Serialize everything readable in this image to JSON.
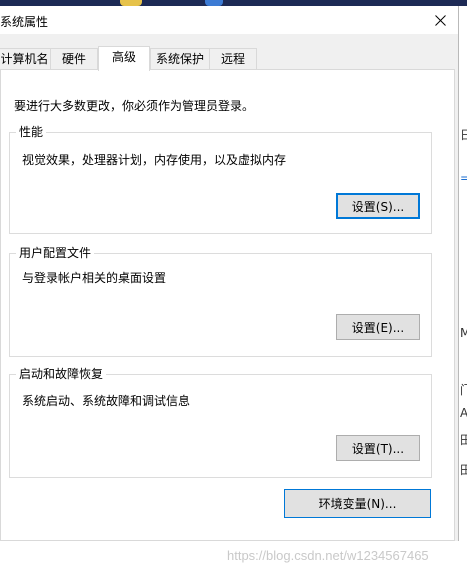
{
  "window": {
    "title": "系统属性",
    "close_icon": "close-icon"
  },
  "tabs": [
    {
      "label": "计算机名",
      "active": false
    },
    {
      "label": "硬件",
      "active": false
    },
    {
      "label": "高级",
      "active": true
    },
    {
      "label": "系统保护",
      "active": false
    },
    {
      "label": "远程",
      "active": false
    }
  ],
  "admin_note": "要进行大多数更改，你必须作为管理员登录。",
  "groups": {
    "performance": {
      "title": "性能",
      "description": "视觉效果，处理器计划，内存使用，以及虚拟内存",
      "button": "设置(S)..."
    },
    "user_profiles": {
      "title": "用户配置文件",
      "description": "与登录帐户相关的桌面设置",
      "button": "设置(E)..."
    },
    "startup_recovery": {
      "title": "启动和故障恢复",
      "description": "系统启动、系统故障和调试信息",
      "button": "设置(T)..."
    }
  },
  "env_button": "环境变量(N)...",
  "watermark": "https://blog.csdn.net/w1234567465",
  "background_window": {
    "chars": [
      "日",
      "=",
      "M",
      "门",
      "A",
      "田",
      "田"
    ]
  },
  "colors": {
    "accent": "#0078d7",
    "button_bg": "#e1e1e1",
    "dialog_bg": "#f0f0f0"
  }
}
